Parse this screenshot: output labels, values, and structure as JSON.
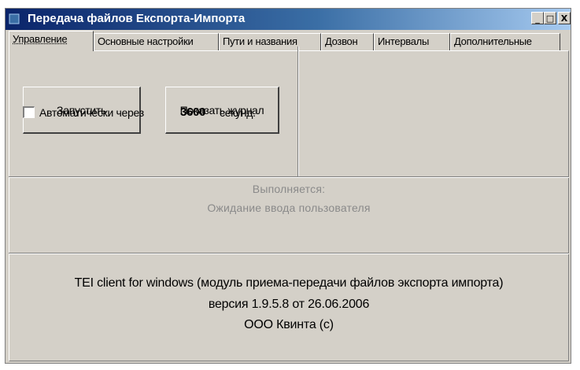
{
  "window": {
    "title": "Передача файлов Експорта-Импорта",
    "minimize": "_",
    "maximize": "□",
    "close": "X"
  },
  "tabs": [
    {
      "label": "Управление",
      "active": true
    },
    {
      "label": "Основные настройки",
      "active": false
    },
    {
      "label": "Пути и названия",
      "active": false
    },
    {
      "label": "Дозвон",
      "active": false
    },
    {
      "label": "Интервалы",
      "active": false
    },
    {
      "label": "Дополнительные",
      "active": false
    }
  ],
  "controls": {
    "start_button": "Запустить",
    "show_log_button": "Показать журнал",
    "auto_checkbox_checked": false,
    "auto_label": "Автоматически через",
    "auto_seconds": "3600",
    "seconds_label": "секунд."
  },
  "status": {
    "heading": "Выполняется:",
    "text": "Ожидание ввода пользователя"
  },
  "about": {
    "line1": "TEI client for windows  (модуль приема-передачи файлов экспорта импорта)",
    "line2": "версия 1.9.5.8 от 26.06.2006",
    "line3": "ООО Квинта (с)"
  }
}
